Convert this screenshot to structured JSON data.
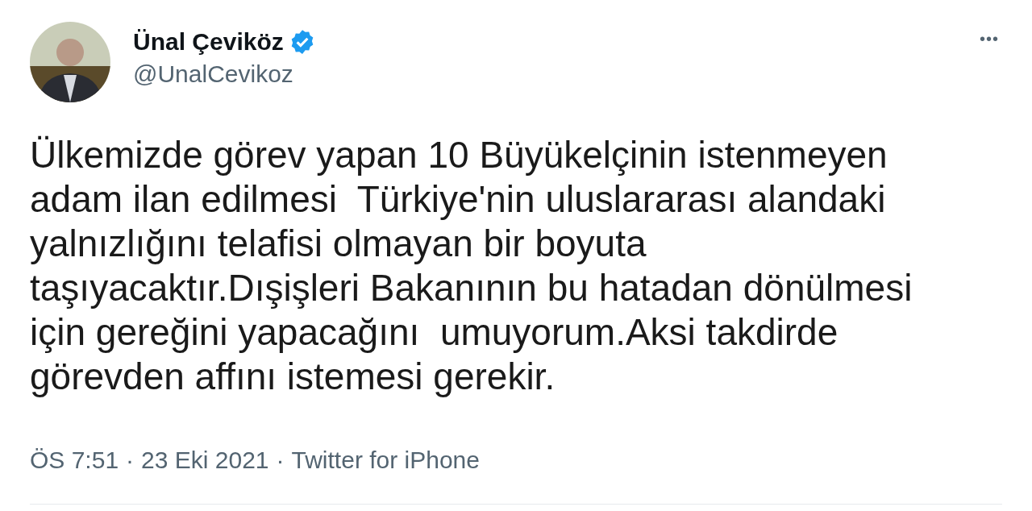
{
  "author": {
    "name": "Ünal Çeviköz",
    "verified": true,
    "handle": "@UnalCevikoz"
  },
  "more": "•••",
  "text": "Ülkemizde görev yapan 10 Büyükelçinin istenmeyen\nadam ilan edilmesi  Türkiye'nin uluslararası alandaki\nyalnızlığını telafisi olmayan bir boyuta\ntaşıyacaktır.Dışişleri Bakanının bu hatadan dönülmesi\niçin gereğini yapacağını  umuyorum.Aksi takdirde\ngörevden affını istemesi gerekir.",
  "meta": {
    "time": "ÖS 7:51",
    "separator_1": "·",
    "date": "23 Eki 2021",
    "separator_2": "·",
    "source": "Twitter for iPhone"
  }
}
